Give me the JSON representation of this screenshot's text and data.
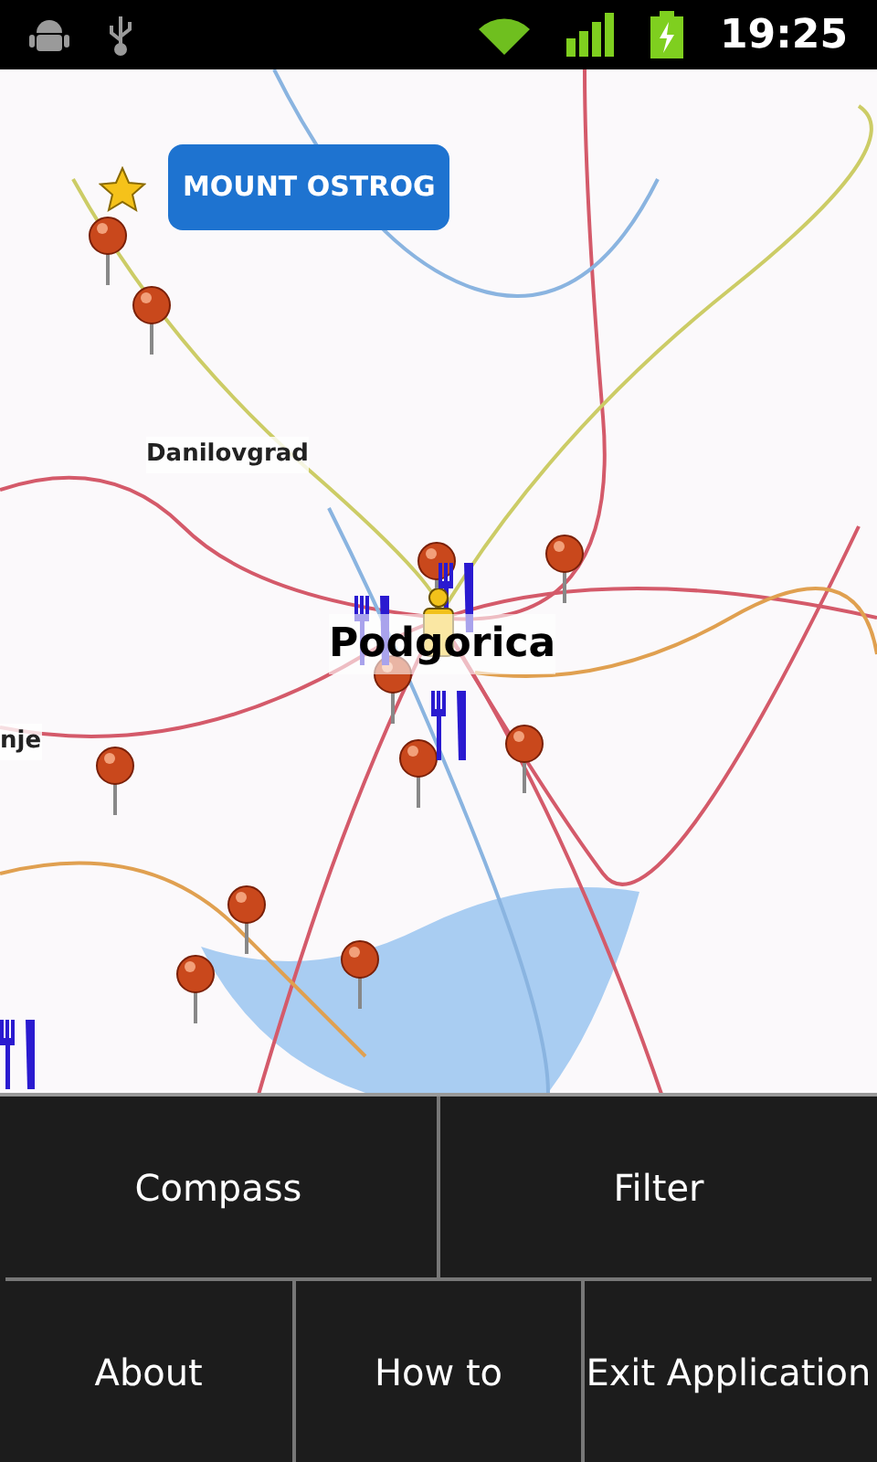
{
  "status_bar": {
    "time": "19:25"
  },
  "map": {
    "callout": "MOUNT OSTROG",
    "places": [
      {
        "label": "Danilovgrad",
        "kind": "town"
      },
      {
        "label": "Podgorica",
        "kind": "city"
      },
      {
        "label": "nje",
        "kind": "town"
      }
    ]
  },
  "options_menu": {
    "upper_items": [
      "Compass",
      "Filter"
    ],
    "lower_items": [
      "About",
      "How to",
      "Exit Application"
    ]
  }
}
